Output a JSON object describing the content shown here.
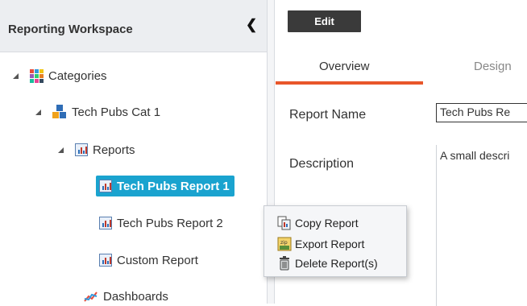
{
  "sidebar": {
    "title": "Reporting Workspace",
    "tree": {
      "categories": "Categories",
      "category1": "Tech Pubs Cat 1",
      "reports": "Reports",
      "report1": "Tech Pubs Report 1",
      "report2": "Tech Pubs Report 2",
      "report3": "Custom Report",
      "dashboards": "Dashboards"
    }
  },
  "toolbar": {
    "edit_label": "Edit"
  },
  "tabs": [
    {
      "label": "Overview"
    },
    {
      "label": "Design"
    }
  ],
  "form": {
    "report_name_label": "Report Name",
    "report_name_value": "Tech Pubs Re",
    "description_label": "Description",
    "description_value": "A small descri"
  },
  "context_menu": {
    "items": [
      {
        "label": "Copy Report",
        "icon": "copy-icon"
      },
      {
        "label": "Export Report",
        "icon": "export-icon"
      },
      {
        "label": "Delete Report(s)",
        "icon": "trash-icon"
      }
    ]
  },
  "colors": {
    "accent": "#e8562a",
    "selection": "#1aa3cf"
  }
}
